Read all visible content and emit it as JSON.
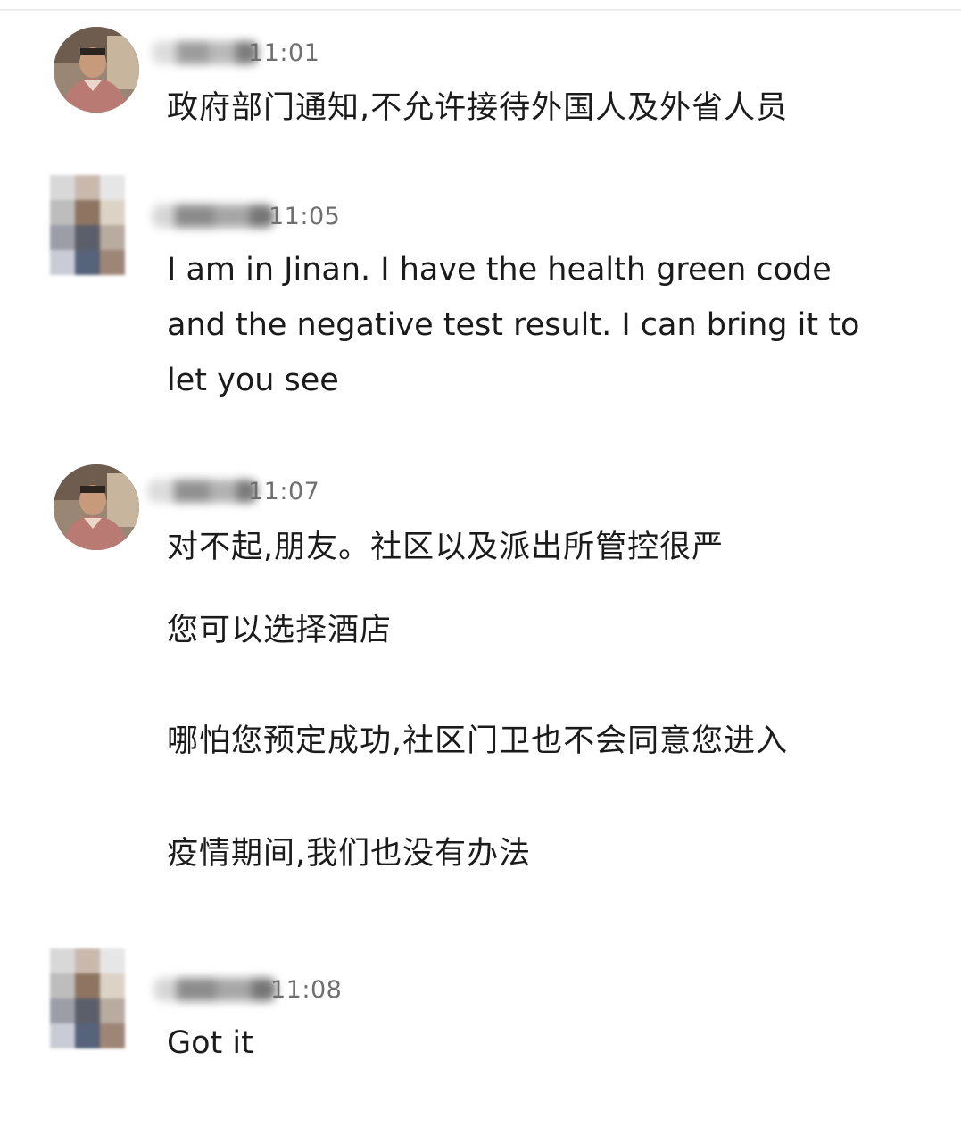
{
  "colors": {
    "background": "#ffffff",
    "text": "#1b1b1b",
    "time": "#6f6f6f"
  },
  "messages": [
    {
      "sender": "host",
      "avatar": "host-photo",
      "time": "11:01",
      "lines": [
        "政府部门通知,不允许接待外国人及外省人员"
      ]
    },
    {
      "sender": "guest",
      "avatar": "pixelated",
      "time": "11:05",
      "lines": [
        "I am in Jinan.  I have the health green code",
        "and the negative test result. I can bring it to",
        "let you see"
      ]
    },
    {
      "sender": "host",
      "avatar": "host-photo",
      "time": "11:07",
      "lines": [
        "对不起,朋友。社区以及派出所管控很严",
        "您可以选择酒店",
        "哪怕您预定成功,社区门卫也不会同意您进入",
        "疫情期间,我们也没有办法"
      ]
    },
    {
      "sender": "guest",
      "avatar": "pixelated",
      "time": "11:08",
      "lines": [
        "Got it"
      ]
    }
  ]
}
